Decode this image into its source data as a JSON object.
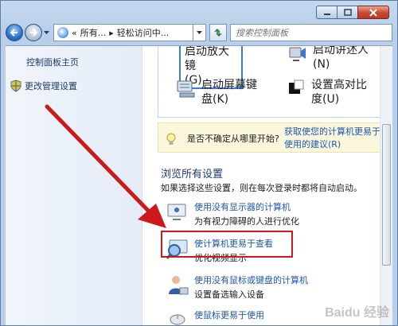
{
  "navbar": {
    "address_crumbs": [
      "«",
      "所有...",
      "▸",
      "轻松访问中..."
    ],
    "search_placeholder": "搜索控制面板"
  },
  "sidebar": {
    "home_label": "控制面板主页",
    "manage_label": "更改管理设置"
  },
  "tools": {
    "magnifier": "启动放大镜\n(G)",
    "narrator": "启动讲述人\n(N)",
    "keyboard": "启动屏幕键\n盘(K)",
    "contrast": "设置高对比\n度(U)"
  },
  "hint": {
    "question": "是否不确定从哪里开始?",
    "link": "获取使您的计算机更易于使用的建议(R)"
  },
  "browse": {
    "title": "浏览所有设置",
    "description": "如果选择这些设置，则在每次登录时都将自动启动。",
    "settings": [
      {
        "link": "使用没有显示器的计算机",
        "desc": "为有视力障碍的人进行优化"
      },
      {
        "link": "使计算机更易于查看",
        "desc": "优化视频显示"
      },
      {
        "link": "使用没有鼠标或键盘的计算机",
        "desc": "设置备选输入设备"
      },
      {
        "link": "使鼠标更易于使用",
        "desc": ""
      }
    ]
  },
  "colors": {
    "highlight": "#d01818",
    "arrow": "#cc1a1a",
    "link": "#1e56b5"
  },
  "watermark": "Baidu 经验"
}
